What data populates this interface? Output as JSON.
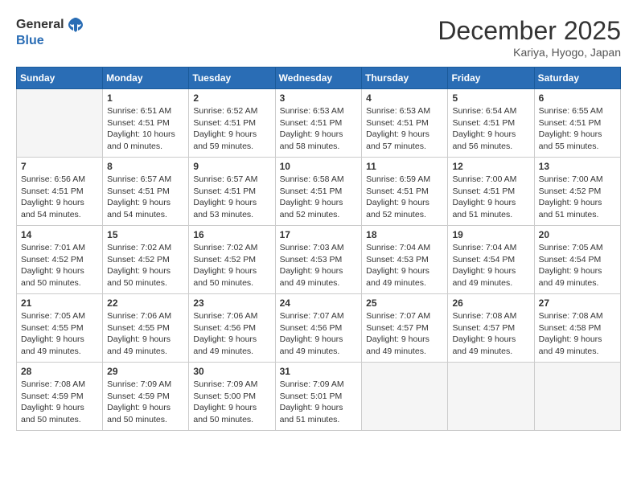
{
  "header": {
    "logo_line1": "General",
    "logo_line2": "Blue",
    "month_title": "December 2025",
    "location": "Kariya, Hyogo, Japan"
  },
  "days_of_week": [
    "Sunday",
    "Monday",
    "Tuesday",
    "Wednesday",
    "Thursday",
    "Friday",
    "Saturday"
  ],
  "weeks": [
    [
      {
        "day": "",
        "empty": true
      },
      {
        "day": "1",
        "sunrise": "6:51 AM",
        "sunset": "4:51 PM",
        "daylight": "10 hours and 0 minutes."
      },
      {
        "day": "2",
        "sunrise": "6:52 AM",
        "sunset": "4:51 PM",
        "daylight": "9 hours and 59 minutes."
      },
      {
        "day": "3",
        "sunrise": "6:53 AM",
        "sunset": "4:51 PM",
        "daylight": "9 hours and 58 minutes."
      },
      {
        "day": "4",
        "sunrise": "6:53 AM",
        "sunset": "4:51 PM",
        "daylight": "9 hours and 57 minutes."
      },
      {
        "day": "5",
        "sunrise": "6:54 AM",
        "sunset": "4:51 PM",
        "daylight": "9 hours and 56 minutes."
      },
      {
        "day": "6",
        "sunrise": "6:55 AM",
        "sunset": "4:51 PM",
        "daylight": "9 hours and 55 minutes."
      }
    ],
    [
      {
        "day": "7",
        "sunrise": "6:56 AM",
        "sunset": "4:51 PM",
        "daylight": "9 hours and 54 minutes."
      },
      {
        "day": "8",
        "sunrise": "6:57 AM",
        "sunset": "4:51 PM",
        "daylight": "9 hours and 54 minutes."
      },
      {
        "day": "9",
        "sunrise": "6:57 AM",
        "sunset": "4:51 PM",
        "daylight": "9 hours and 53 minutes."
      },
      {
        "day": "10",
        "sunrise": "6:58 AM",
        "sunset": "4:51 PM",
        "daylight": "9 hours and 52 minutes."
      },
      {
        "day": "11",
        "sunrise": "6:59 AM",
        "sunset": "4:51 PM",
        "daylight": "9 hours and 52 minutes."
      },
      {
        "day": "12",
        "sunrise": "7:00 AM",
        "sunset": "4:51 PM",
        "daylight": "9 hours and 51 minutes."
      },
      {
        "day": "13",
        "sunrise": "7:00 AM",
        "sunset": "4:52 PM",
        "daylight": "9 hours and 51 minutes."
      }
    ],
    [
      {
        "day": "14",
        "sunrise": "7:01 AM",
        "sunset": "4:52 PM",
        "daylight": "9 hours and 50 minutes."
      },
      {
        "day": "15",
        "sunrise": "7:02 AM",
        "sunset": "4:52 PM",
        "daylight": "9 hours and 50 minutes."
      },
      {
        "day": "16",
        "sunrise": "7:02 AM",
        "sunset": "4:52 PM",
        "daylight": "9 hours and 50 minutes."
      },
      {
        "day": "17",
        "sunrise": "7:03 AM",
        "sunset": "4:53 PM",
        "daylight": "9 hours and 49 minutes."
      },
      {
        "day": "18",
        "sunrise": "7:04 AM",
        "sunset": "4:53 PM",
        "daylight": "9 hours and 49 minutes."
      },
      {
        "day": "19",
        "sunrise": "7:04 AM",
        "sunset": "4:54 PM",
        "daylight": "9 hours and 49 minutes."
      },
      {
        "day": "20",
        "sunrise": "7:05 AM",
        "sunset": "4:54 PM",
        "daylight": "9 hours and 49 minutes."
      }
    ],
    [
      {
        "day": "21",
        "sunrise": "7:05 AM",
        "sunset": "4:55 PM",
        "daylight": "9 hours and 49 minutes."
      },
      {
        "day": "22",
        "sunrise": "7:06 AM",
        "sunset": "4:55 PM",
        "daylight": "9 hours and 49 minutes."
      },
      {
        "day": "23",
        "sunrise": "7:06 AM",
        "sunset": "4:56 PM",
        "daylight": "9 hours and 49 minutes."
      },
      {
        "day": "24",
        "sunrise": "7:07 AM",
        "sunset": "4:56 PM",
        "daylight": "9 hours and 49 minutes."
      },
      {
        "day": "25",
        "sunrise": "7:07 AM",
        "sunset": "4:57 PM",
        "daylight": "9 hours and 49 minutes."
      },
      {
        "day": "26",
        "sunrise": "7:08 AM",
        "sunset": "4:57 PM",
        "daylight": "9 hours and 49 minutes."
      },
      {
        "day": "27",
        "sunrise": "7:08 AM",
        "sunset": "4:58 PM",
        "daylight": "9 hours and 49 minutes."
      }
    ],
    [
      {
        "day": "28",
        "sunrise": "7:08 AM",
        "sunset": "4:59 PM",
        "daylight": "9 hours and 50 minutes."
      },
      {
        "day": "29",
        "sunrise": "7:09 AM",
        "sunset": "4:59 PM",
        "daylight": "9 hours and 50 minutes."
      },
      {
        "day": "30",
        "sunrise": "7:09 AM",
        "sunset": "5:00 PM",
        "daylight": "9 hours and 50 minutes."
      },
      {
        "day": "31",
        "sunrise": "7:09 AM",
        "sunset": "5:01 PM",
        "daylight": "9 hours and 51 minutes."
      },
      {
        "day": "",
        "empty": true
      },
      {
        "day": "",
        "empty": true
      },
      {
        "day": "",
        "empty": true
      }
    ]
  ]
}
